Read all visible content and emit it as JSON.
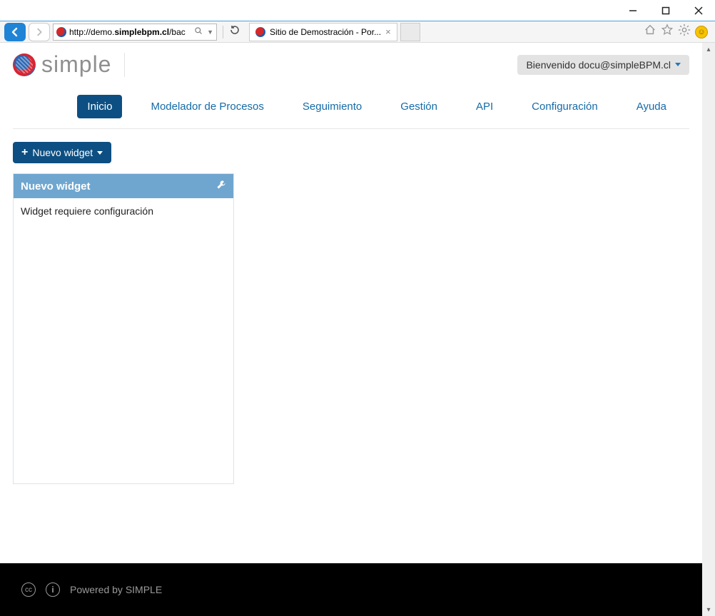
{
  "browser": {
    "url_prefix": "http://demo.",
    "url_bold": "simplebpm.cl",
    "url_suffix": "/bac",
    "tab_title": "Sitio de Demostración - Por..."
  },
  "header": {
    "brand": "simple",
    "user_greeting": "Bienvenido docu@simpleBPM.cl"
  },
  "nav": {
    "items": [
      {
        "label": "Inicio",
        "active": true
      },
      {
        "label": "Modelador de Procesos",
        "active": false
      },
      {
        "label": "Seguimiento",
        "active": false
      },
      {
        "label": "Gestión",
        "active": false
      },
      {
        "label": "API",
        "active": false
      },
      {
        "label": "Configuración",
        "active": false
      },
      {
        "label": "Ayuda",
        "active": false
      }
    ]
  },
  "toolbar": {
    "new_widget_btn": "Nuevo widget"
  },
  "widget": {
    "title": "Nuevo widget",
    "body": "Widget requiere configuración"
  },
  "footer": {
    "powered": "Powered by SIMPLE"
  }
}
